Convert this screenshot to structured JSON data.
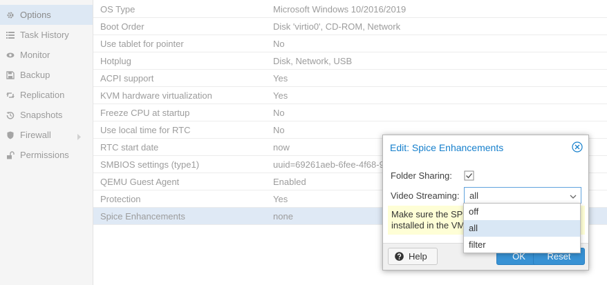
{
  "sidebar": {
    "items": [
      {
        "label": "Options",
        "icon": "gear-icon",
        "active": true
      },
      {
        "label": "Task History",
        "icon": "list-icon"
      },
      {
        "label": "Monitor",
        "icon": "eye-icon"
      },
      {
        "label": "Backup",
        "icon": "floppy-icon"
      },
      {
        "label": "Replication",
        "icon": "retweet-icon"
      },
      {
        "label": "Snapshots",
        "icon": "history-icon"
      },
      {
        "label": "Firewall",
        "icon": "shield-icon",
        "has_submenu": true
      },
      {
        "label": "Permissions",
        "icon": "unlock-icon"
      }
    ]
  },
  "options": {
    "rows": [
      {
        "key": "OS Type",
        "value": "Microsoft Windows 10/2016/2019"
      },
      {
        "key": "Boot Order",
        "value": "Disk 'virtio0', CD-ROM, Network"
      },
      {
        "key": "Use tablet for pointer",
        "value": "No"
      },
      {
        "key": "Hotplug",
        "value": "Disk, Network, USB"
      },
      {
        "key": "ACPI support",
        "value": "Yes"
      },
      {
        "key": "KVM hardware virtualization",
        "value": "Yes"
      },
      {
        "key": "Freeze CPU at startup",
        "value": "No"
      },
      {
        "key": "Use local time for RTC",
        "value": "No"
      },
      {
        "key": "RTC start date",
        "value": "now"
      },
      {
        "key": "SMBIOS settings (type1)",
        "value": "uuid=69261aeb-6fee-4f68-92"
      },
      {
        "key": "QEMU Guest Agent",
        "value": "Enabled"
      },
      {
        "key": "Protection",
        "value": "Yes"
      },
      {
        "key": "Spice Enhancements",
        "value": "none",
        "selected": true
      }
    ]
  },
  "dialog": {
    "title": "Edit: Spice Enhancements",
    "folder_sharing_label": "Folder Sharing:",
    "folder_sharing_checked": true,
    "video_streaming_label": "Video Streaming:",
    "video_streaming_value": "all",
    "warning_line1": "Make sure the SP",
    "warning_line2": "installed in the VM",
    "help_label": "Help",
    "ok_label": "OK",
    "reset_label": "Reset"
  },
  "dropdown": {
    "options": [
      {
        "label": "off"
      },
      {
        "label": "all",
        "selected": true
      },
      {
        "label": "filter"
      }
    ]
  },
  "colors": {
    "accent": "#157fcc",
    "button_blue": "#3892d4",
    "selection": "#dfe9f5",
    "warning_bg": "#fefed6"
  }
}
